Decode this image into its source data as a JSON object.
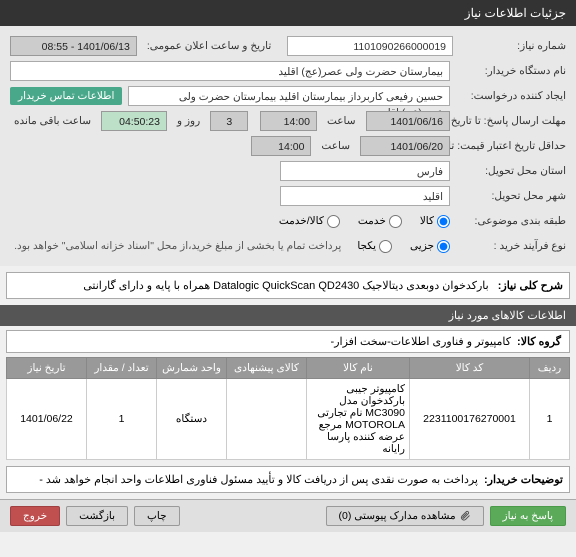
{
  "header": {
    "title": "جزئیات اطلاعات نیاز"
  },
  "form": {
    "need_no_lbl": "شماره نیاز:",
    "need_no": "1101090266000019",
    "announce_lbl": "تاریخ و ساعت اعلان عمومی:",
    "announce_val": "1401/06/13 - 08:55",
    "buyer_dev_lbl": "نام دستگاه خریدار:",
    "buyer_dev": "بیمارستان حضرت ولی عصر(عج) اقلید",
    "req_creator_lbl": "ایجاد کننده درخواست:",
    "req_creator": "حسین رفیعی کاربرداز بیمارستان اقلید بیمارستان حضرت ولی عصر(عج) اقلید",
    "contact_btn": "اطلاعات تماس خریدار",
    "deadline_lbl": "مهلت ارسال پاسخ: تا تاریخ:",
    "deadline_date": "1401/06/16",
    "time_lbl": "ساعت",
    "deadline_time": "14:00",
    "day_lbl": "روز و",
    "days": "3",
    "remain_lbl": "ساعت باقی مانده",
    "remain_time": "04:50:23",
    "min_valid_lbl": "حداقل تاریخ اعتبار قیمت: تا تاریخ:",
    "min_valid_date": "1401/06/20",
    "min_valid_time": "14:00",
    "province_lbl": "استان محل تحویل:",
    "province": "فارس",
    "city_lbl": "شهر محل تحویل:",
    "city": "اقلید",
    "cat_lbl": "طبقه بندی موضوعی:",
    "cat_goods": "کالا",
    "cat_service": "خدمت",
    "cat_both": "کالا/خدمت",
    "buy_type_lbl": "نوع فرآیند خرید :",
    "buy_partial": "جزیی",
    "buy_full": "یکجا",
    "buy_note": "پرداخت تمام یا بخشی از مبلغ خرید،از محل \"اسناد خزانه اسلامی\" خواهد بود."
  },
  "desc": {
    "lbl": "شرح کلی نیاز:",
    "text": "بارکدخوان دوبعدی دیتالاجیک Datalogic QuickScan QD2430 همراه با پایه و دارای گارانتی"
  },
  "items_header": "اطلاعات کالاهای مورد نیاز",
  "group": {
    "lbl": "گروه کالا:",
    "text": "کامپیوتر و فناوری اطلاعات-سخت افزار-"
  },
  "table": {
    "cols": [
      "ردیف",
      "کد کالا",
      "نام کالا",
      "کالای پیشنهادی",
      "واحد شمارش",
      "تعداد / مقدار",
      "تاریخ نیاز"
    ],
    "rows": [
      {
        "idx": "1",
        "code": "2231100176270001",
        "name": "کامپیوتر جیبی بارکدخوان مدل MC3090 نام تجارتی MOTOROLA مرجع عرضه کننده پارسا رایانه",
        "suggest": "",
        "unit": "دستگاه",
        "qty": "1",
        "date": "1401/06/22"
      }
    ]
  },
  "buyer_notes": {
    "lbl": "توضیحات خریدار:",
    "text": "پرداخت به صورت نقدی پس از دریافت کالا و تأیید مسئول فناوری اطلاعات واحد انجام خواهد شد -"
  },
  "footer": {
    "reply": "پاسخ به نیاز",
    "attach": "مشاهده مدارک پیوستی (0)",
    "print": "چاپ",
    "back": "بازگشت",
    "exit": "خروج"
  }
}
